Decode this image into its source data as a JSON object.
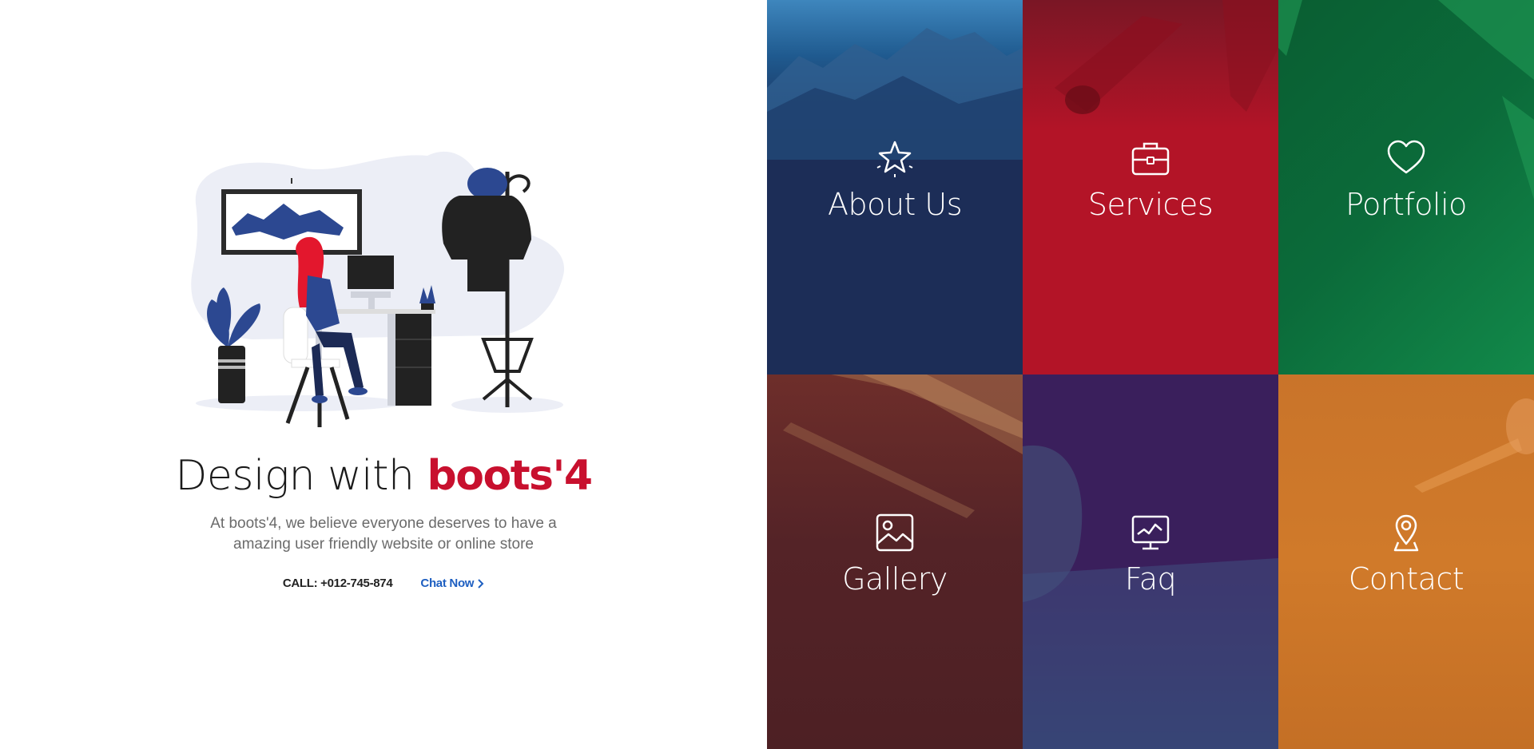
{
  "hero": {
    "headline_prefix": "Design with ",
    "headline_brand": "boots'4",
    "subtext_line1": "At boots'4, we believe everyone deserves to have a",
    "subtext_line2": "amazing user friendly website or online store",
    "call_label": "CALL: +012-745-874",
    "chat_label": "Chat Now",
    "brand_color": "#c8102e",
    "link_color": "#1e5fc1"
  },
  "tiles": [
    {
      "label": "About Us",
      "icon": "star-icon",
      "color": "#1c2d57"
    },
    {
      "label": "Services",
      "icon": "briefcase-icon",
      "color": "#b31427"
    },
    {
      "label": "Portfolio",
      "icon": "heart-icon",
      "color": "#0b6b3a"
    },
    {
      "label": "Gallery",
      "icon": "image-icon",
      "color": "#542327"
    },
    {
      "label": "Faq",
      "icon": "monitor-chart-icon",
      "color": "#3a1f5c"
    },
    {
      "label": "Contact",
      "icon": "map-pin-icon",
      "color": "#d07a2a"
    }
  ]
}
